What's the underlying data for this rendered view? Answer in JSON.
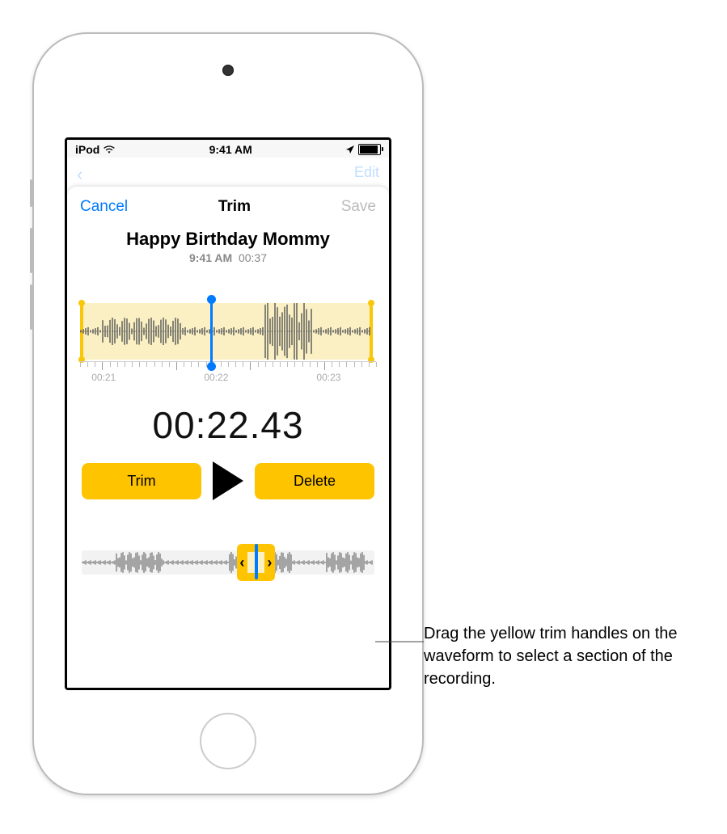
{
  "status_bar": {
    "carrier": "iPod",
    "time": "9:41 AM",
    "location_icon": "location-arrow",
    "battery_pct": 85
  },
  "background": {
    "edit_label": "Edit"
  },
  "sheet": {
    "cancel_label": "Cancel",
    "title": "Trim",
    "save_label": "Save",
    "save_enabled": false
  },
  "recording": {
    "title": "Happy Birthday Mommy",
    "timestamp": "9:41 AM",
    "duration": "00:37"
  },
  "detail_timeline": {
    "labels": [
      "00:21",
      "00:22",
      "00:23"
    ],
    "label_positions_pct": [
      8,
      46,
      84
    ]
  },
  "current_time": "00:22.43",
  "controls": {
    "trim_label": "Trim",
    "delete_label": "Delete"
  },
  "overview": {
    "selection_start_pct": 53,
    "selection_width_pct": 13,
    "playhead_pct": 59
  },
  "callout": {
    "text": "Drag the yellow trim handles on the waveform to select a section of the recording."
  }
}
